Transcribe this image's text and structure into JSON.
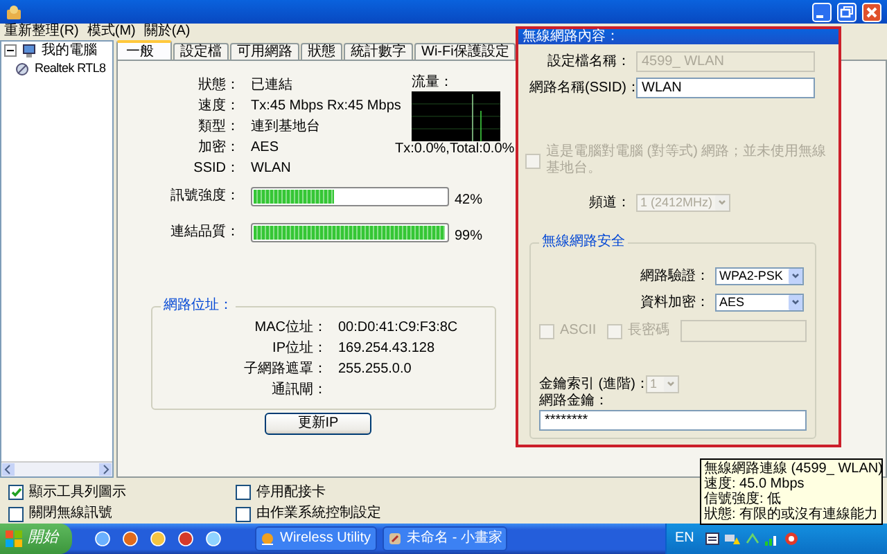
{
  "menu": [
    "重新整理(R)",
    "模式(M)",
    "關於(A)"
  ],
  "tree": [
    {
      "label": "我的電腦",
      "expanded": true,
      "children": [
        {
          "label": "Realtek RTL8"
        }
      ]
    }
  ],
  "tabs": [
    {
      "label": "一般",
      "selected": true
    },
    {
      "label": "設定檔",
      "selected": false
    },
    {
      "label": "可用網路",
      "selected": false
    },
    {
      "label": "狀態",
      "selected": false
    },
    {
      "label": "統計數字",
      "selected": false
    },
    {
      "label": "Wi-Fi保護設定",
      "selected": false
    }
  ],
  "general": {
    "rows": [
      {
        "label": "狀態：",
        "value": "已連結"
      },
      {
        "label": "速度：",
        "value": "Tx:45 Mbps Rx:45 Mbps"
      },
      {
        "label": "類型：",
        "value": "連到基地台"
      },
      {
        "label": "加密：",
        "value": "AES"
      },
      {
        "label": "SSID：",
        "value": "WLAN"
      }
    ],
    "traffic": {
      "label": "流量：",
      "reading": "Tx:0.0%,Total:0.0%"
    },
    "meters": [
      {
        "label": "訊號強度：",
        "level": 0.42,
        "reading": "42%"
      },
      {
        "label": "連結品質：",
        "level": 0.99,
        "reading": "99%"
      }
    ],
    "address": {
      "legend": "網路位址：",
      "rows": [
        {
          "label": "MAC位址：",
          "value": "00:D0:41:C9:F3:8C"
        },
        {
          "label": "IP位址：",
          "value": "169.254.43.128"
        },
        {
          "label": "子網路遮罩：",
          "value": "255.255.0.0"
        },
        {
          "label": "通訊閘：",
          "value": ""
        }
      ]
    },
    "button": "更新IP"
  },
  "options": [
    {
      "label": "顯示工具列圖示",
      "checked": true
    },
    {
      "label": "停用配接卡",
      "checked": false
    },
    {
      "label": "關閉無線訊號",
      "checked": false
    },
    {
      "label": "由作業系統控制設定",
      "checked": false
    }
  ],
  "dialog": {
    "title": "無線網路內容：",
    "profile": {
      "label": "設定檔名稱：",
      "value": "4599_ WLAN",
      "disabled": true
    },
    "ssid": {
      "label": "網路名稱(SSID)：",
      "value": "WLAN",
      "disabled": false
    },
    "adhoc": {
      "label": "這是電腦對電腦 (對等式) 網路；並未使用無線基地台。",
      "checked": false,
      "disabled": true
    },
    "channel": {
      "label": "頻道：",
      "value": "1 (2412MHz)",
      "disabled": true
    },
    "security": {
      "legend": "無線網路安全",
      "auth": {
        "label": "網路驗證：",
        "value": "WPA2-PSK",
        "disabled": false
      },
      "encryption": {
        "label": "資料加密：",
        "value": "AES",
        "disabled": false
      },
      "checks": [
        {
          "label": "ASCII",
          "checked": false,
          "disabled": true
        },
        {
          "label": "長密碼",
          "checked": false,
          "disabled": true
        }
      ],
      "key_index": {
        "label": "金鑰索引 (進階)：",
        "value": "1",
        "disabled": true
      },
      "key": {
        "label": "網路金鑰：",
        "value": "********",
        "disabled": false
      }
    }
  },
  "taskbar": {
    "start": "開始",
    "tasks": [
      "Wireless Utility",
      "未命名 - 小畫家"
    ],
    "language": "EN"
  },
  "tooltip": [
    "無線網路連線 (4599_ WLAN)",
    "速度: 45.0 Mbps",
    "信號強度: 低",
    "狀態: 有限的或沒有連線能力"
  ]
}
